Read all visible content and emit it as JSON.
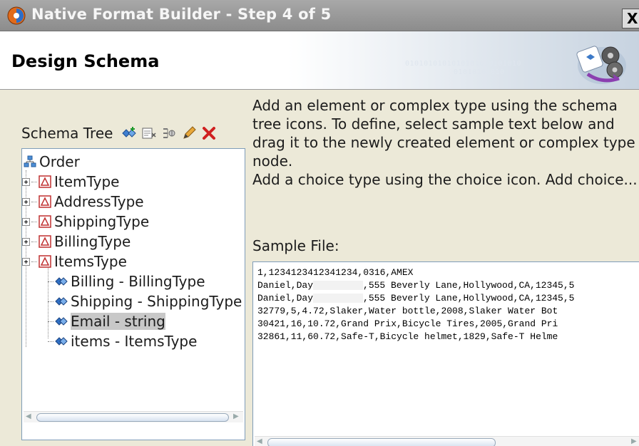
{
  "window": {
    "title": "Native Format Builder - Step 4 of 5",
    "close_label": "X"
  },
  "header": {
    "title": "Design Schema",
    "binary_text_1": "0101010101010101010101010",
    "binary_text_2": "01010101010"
  },
  "schema_tree": {
    "label": "Schema Tree",
    "toolbar_icons": [
      "add-element-icon",
      "add-complex-type-icon",
      "add-choice-icon",
      "edit-icon",
      "delete-icon"
    ],
    "root": "Order",
    "types": [
      "ItemType",
      "AddressType",
      "ShippingType",
      "BillingType",
      "ItemsType"
    ],
    "elements": [
      "Billing - BillingType",
      "Shipping - ShippingType",
      "Email - string",
      "items - ItemsType"
    ],
    "selected": "Email - string"
  },
  "instructions": {
    "line1": "Add an element or complex type using the schema",
    "line2": "tree icons. To define, select sample text below and",
    "line3": "drag it to the newly created element or complex type",
    "line4": "node.",
    "line5": "Add a choice type using the choice icon. Add choice..."
  },
  "sample": {
    "label": "Sample File:",
    "lines": [
      "1,1234123412341234,0316,AMEX",
      ",555 Beverly Lane,Hollywood,CA,12345,5",
      ",555 Beverly Lane,Hollywood,CA,12345,5",
      "32779,5,4.72,Slaker,Water bottle,2008,Slaker Water Bot",
      "30421,16,10.72,Grand Prix,Bicycle Tires,2005,Grand Pri",
      "32861,11,60.72,Safe-T,Bicycle helmet,1829,Safe-T Helme"
    ],
    "name_prefix": "Daniel,Day"
  },
  "colors": {
    "title_bar": "#8c8c8c",
    "selection": "#c8c8c8",
    "delete_red": "#d02020"
  }
}
